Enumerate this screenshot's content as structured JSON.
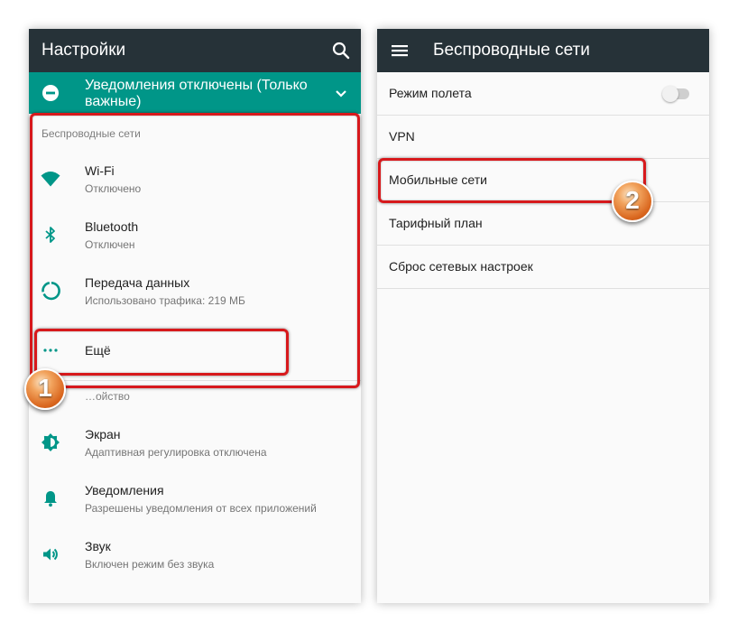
{
  "colors": {
    "appbar": "#263238",
    "accent": "#009688",
    "highlight": "#d7191c",
    "badge": "#e07a2e"
  },
  "left_screen": {
    "title": "Настройки",
    "search_icon": "search-icon",
    "banner": {
      "text": "Уведомления отключены (Только важные)",
      "icon": "do-not-disturb-icon",
      "expand_icon": "chevron-down-icon"
    },
    "wireless_section": {
      "header": "Беспроводные сети",
      "items": [
        {
          "title": "Wi-Fi",
          "subtitle": "Отключено",
          "icon": "wifi-icon"
        },
        {
          "title": "Bluetooth",
          "subtitle": "Отключен",
          "icon": "bluetooth-icon"
        },
        {
          "title": "Передача данных",
          "subtitle": "Использовано трафика: 219 МБ",
          "icon": "data-usage-icon"
        },
        {
          "title": "Ещё",
          "icon": "more-icon"
        }
      ]
    },
    "device_section": {
      "header": "…ойство",
      "items": [
        {
          "title": "Экран",
          "subtitle": "Адаптивная регулировка отключена",
          "icon": "brightness-icon"
        },
        {
          "title": "Уведомления",
          "subtitle": "Разрешены уведомления от всех приложений",
          "icon": "bell-icon"
        },
        {
          "title": "Звук",
          "subtitle": "Включен режим без звука",
          "icon": "volume-icon"
        }
      ]
    }
  },
  "right_screen": {
    "title": "Беспроводные сети",
    "menu_icon": "hamburger-menu-icon",
    "items": [
      {
        "label": "Режим полета",
        "toggle": false
      },
      {
        "label": "VPN"
      },
      {
        "label": "Мобильные сети"
      },
      {
        "label": "Тарифный план"
      },
      {
        "label": "Сброс сетевых настроек"
      }
    ]
  },
  "callouts": {
    "step1": "1",
    "step2": "2"
  }
}
